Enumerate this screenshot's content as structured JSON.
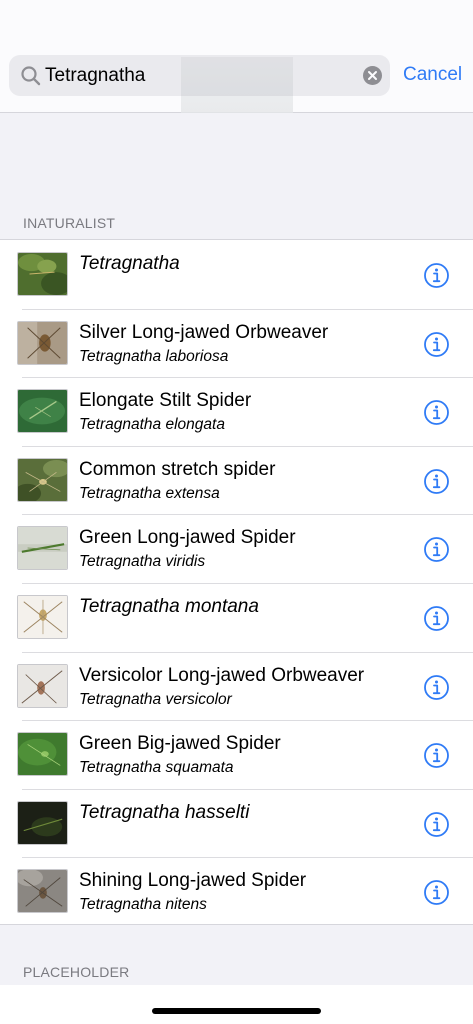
{
  "search": {
    "query": "Tetragnatha",
    "cancel_label": "Cancel"
  },
  "sections": {
    "inaturalist_label": "INATURALIST",
    "placeholder_label": "PLACEHOLDER"
  },
  "results": [
    {
      "title": "Tetragnatha",
      "subtitle": "",
      "title_italic": true
    },
    {
      "title": "Silver Long-jawed Orbweaver",
      "subtitle": "Tetragnatha laboriosa",
      "title_italic": false
    },
    {
      "title": "Elongate Stilt Spider",
      "subtitle": "Tetragnatha elongata",
      "title_italic": false
    },
    {
      "title": "Common stretch spider",
      "subtitle": "Tetragnatha extensa",
      "title_italic": false
    },
    {
      "title": "Green Long-jawed Spider",
      "subtitle": "Tetragnatha viridis",
      "title_italic": false
    },
    {
      "title": "Tetragnatha montana",
      "subtitle": "",
      "title_italic": true
    },
    {
      "title": "Versicolor Long-jawed Orbweaver",
      "subtitle": "Tetragnatha versicolor",
      "title_italic": false
    },
    {
      "title": "Green Big-jawed Spider",
      "subtitle": "Tetragnatha squamata",
      "title_italic": false
    },
    {
      "title": "Tetragnatha hasselti",
      "subtitle": "",
      "title_italic": true
    },
    {
      "title": "Shining Long-jawed Spider",
      "subtitle": "Tetragnatha nitens",
      "title_italic": false
    }
  ],
  "colors": {
    "accent": "#2f7bf6",
    "background": "#f2f2f7",
    "section_text": "#7a7a80"
  },
  "icons": {
    "search": "magnifying-glass",
    "clear": "x-circle-fill",
    "info": "info-circle"
  }
}
